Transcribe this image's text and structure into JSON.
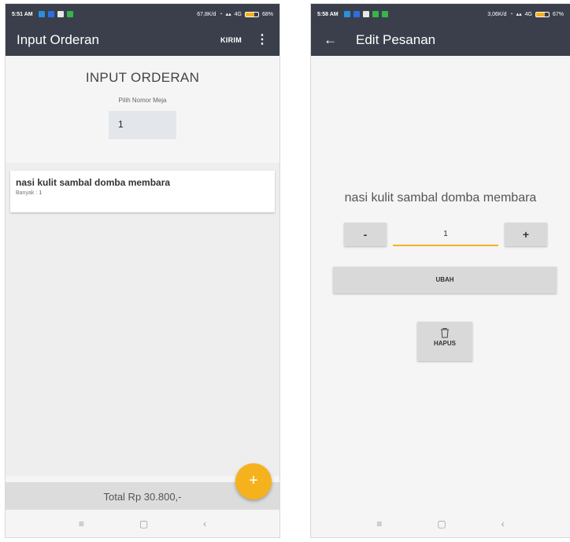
{
  "left": {
    "status": {
      "time": "5:51 AM",
      "speed": "67,8K/d",
      "network": "4G",
      "battery": "68%",
      "battery_level": 0.68
    },
    "appbar": {
      "title": "Input Orderan",
      "action": "KIRIM",
      "menu_glyph": "⋮"
    },
    "header": {
      "title": "INPUT ORDERAN",
      "subtitle": "Pilih Nomor Meja",
      "table_value": "1"
    },
    "items": [
      {
        "name": "nasi kulit sambal domba membara",
        "qty_label": "Banyak",
        "qty_sep": ":",
        "qty": "1"
      }
    ],
    "total": "Total Rp 30.800,-",
    "fab_glyph": "+"
  },
  "right": {
    "status": {
      "time": "5:58 AM",
      "speed": "3,06K/d",
      "network": "4G",
      "battery": "67%",
      "battery_level": 0.67
    },
    "appbar": {
      "back_glyph": "←",
      "title": "Edit Pesanan"
    },
    "item_name": "nasi kulit sambal domba membara",
    "stepper": {
      "minus": "-",
      "value": "1",
      "plus": "+"
    },
    "update_label": "UBAH",
    "delete_label": "HAPUS"
  },
  "nav": {
    "menu": "≡",
    "home": "▢",
    "back": "‹"
  },
  "colors": {
    "bar": "#3a3f4b",
    "accent": "#f6b21c",
    "button": "#d9d9d9"
  },
  "icons": {
    "fab": "plus-icon",
    "back": "arrow-left-icon",
    "menu": "more-vert-icon",
    "delete": "trash-icon"
  }
}
